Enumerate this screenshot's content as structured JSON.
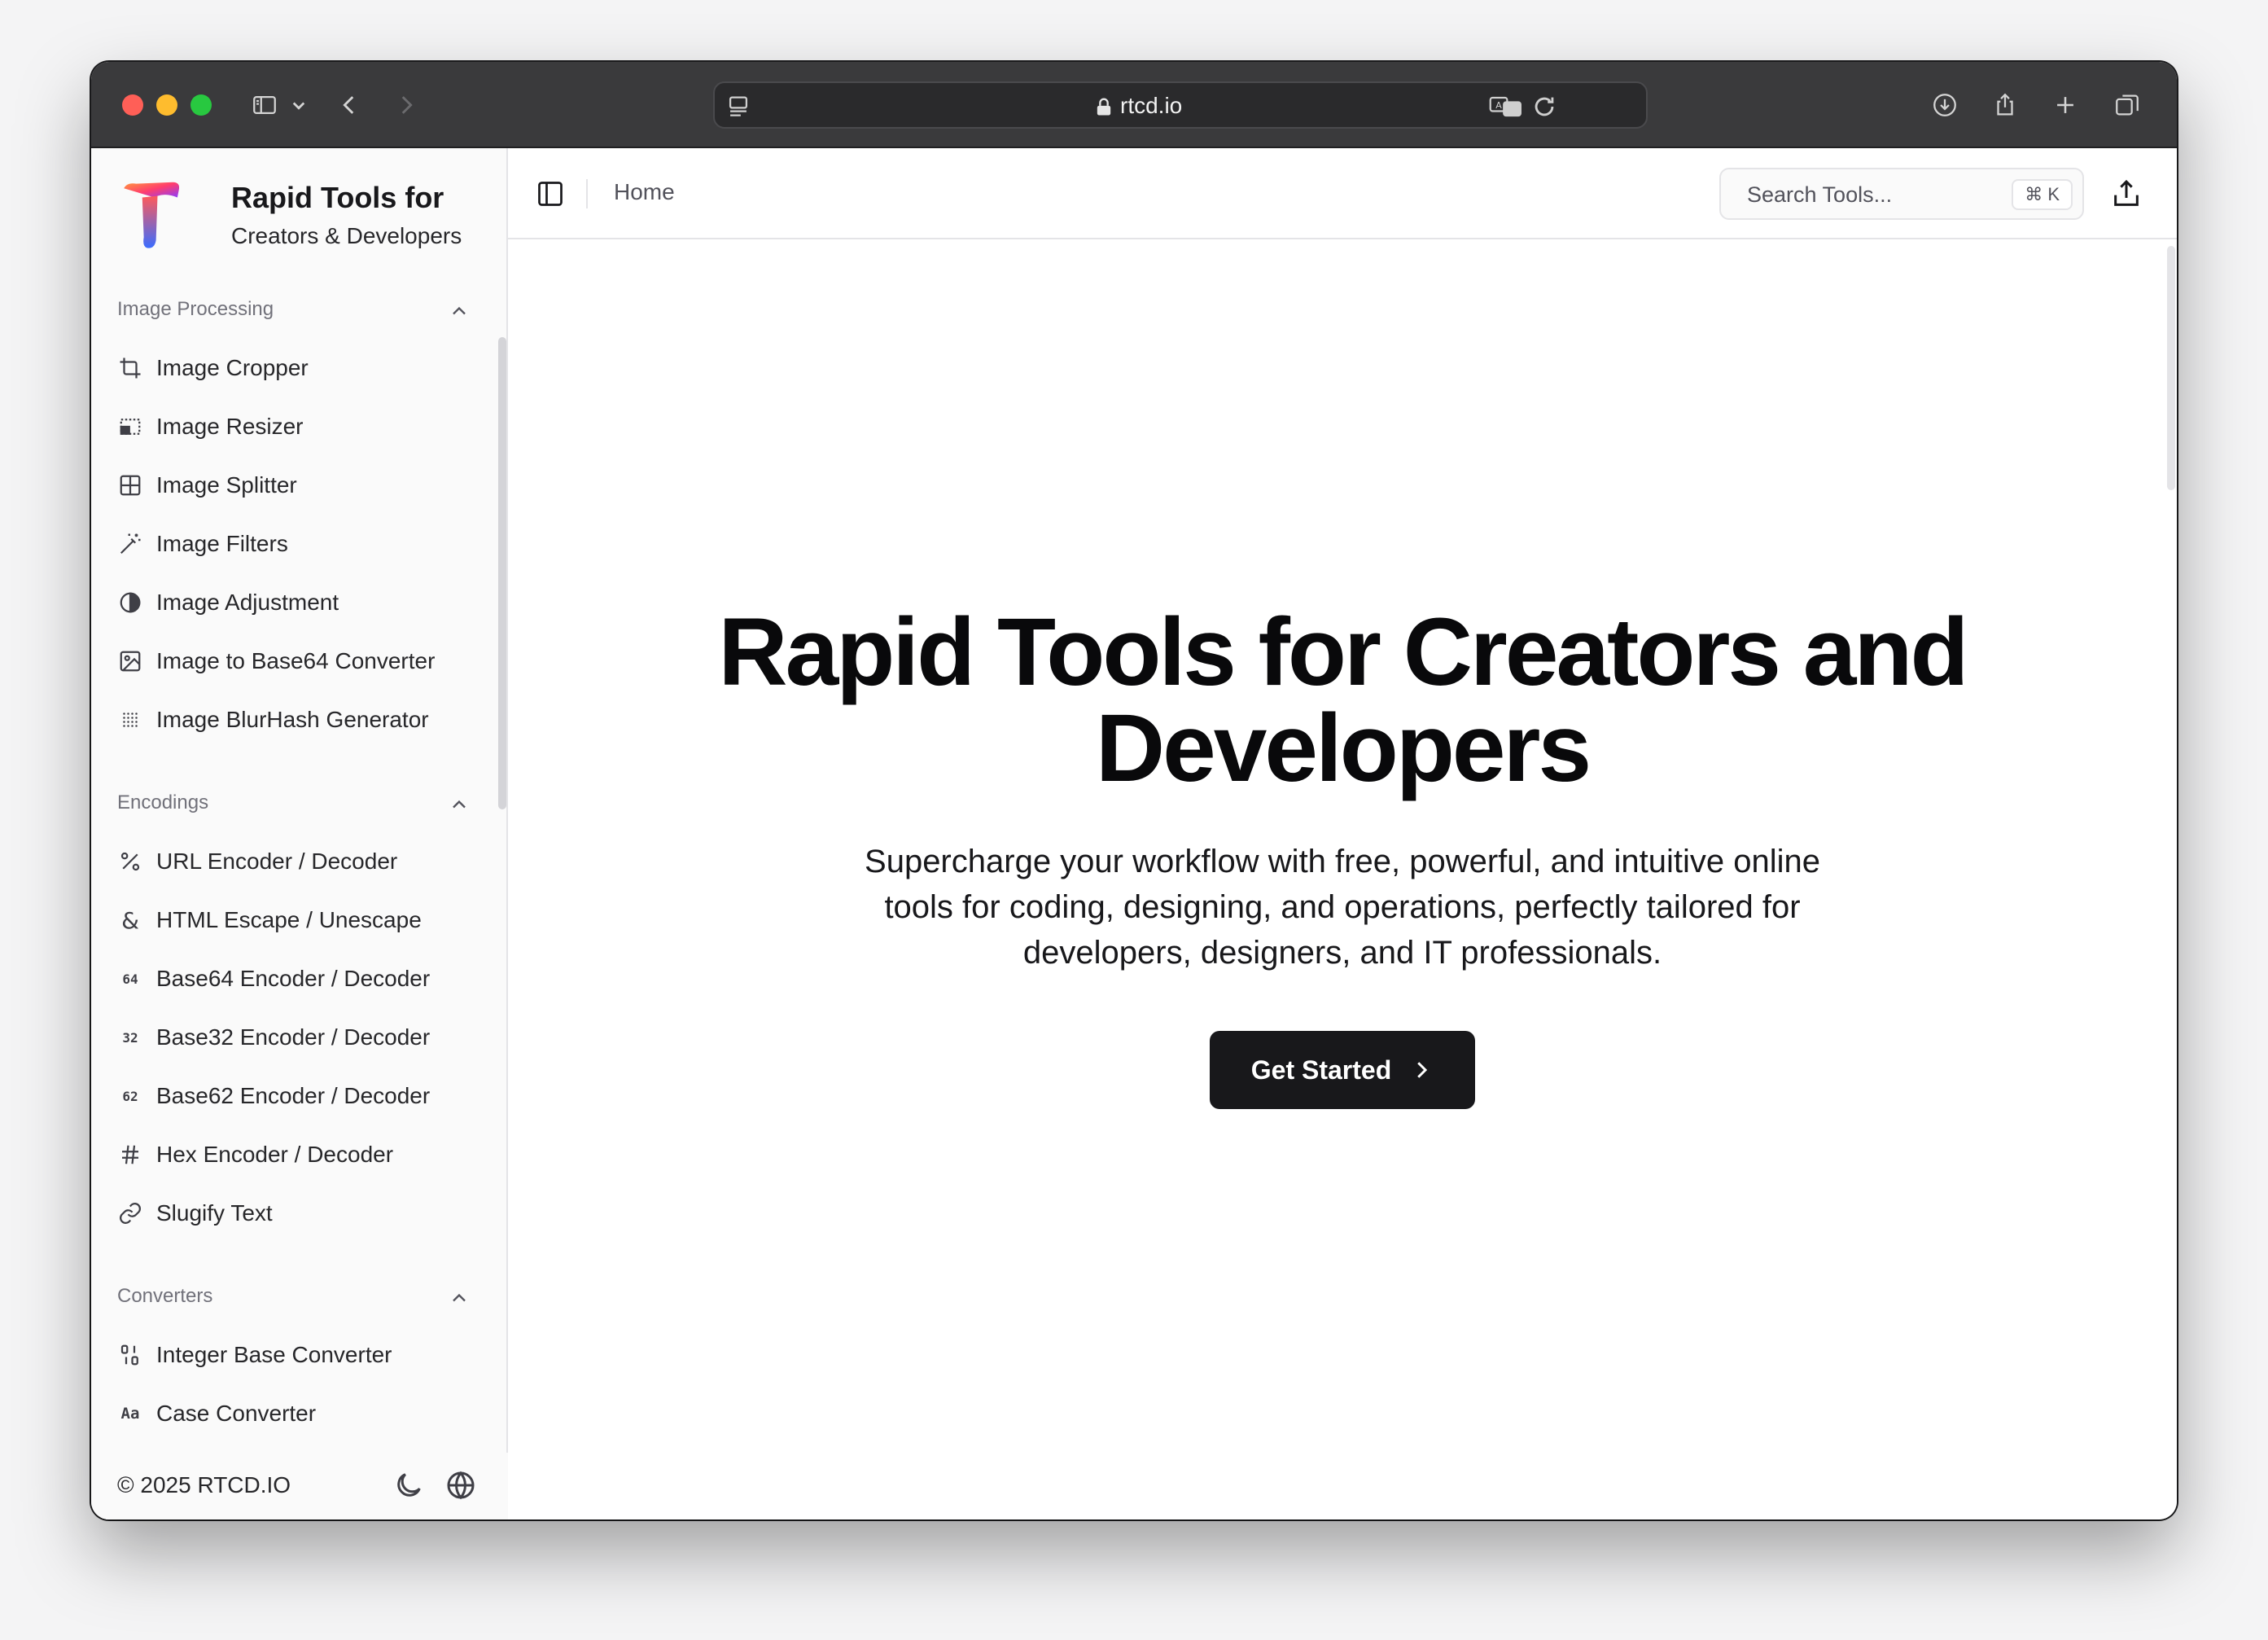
{
  "browser": {
    "url": "rtcd.io"
  },
  "sidebar": {
    "brand_line1": "Rapid Tools for",
    "brand_line2": "Creators & Developers",
    "groups": [
      {
        "title": "Image Processing",
        "items": [
          {
            "label": "Image Cropper",
            "icon": "crop-icon"
          },
          {
            "label": "Image Resizer",
            "icon": "resize-icon"
          },
          {
            "label": "Image Splitter",
            "icon": "grid-icon"
          },
          {
            "label": "Image Filters",
            "icon": "wand-icon"
          },
          {
            "label": "Image Adjustment",
            "icon": "contrast-icon"
          },
          {
            "label": "Image to Base64 Converter",
            "icon": "image-code-icon"
          },
          {
            "label": "Image BlurHash Generator",
            "icon": "dots-grid-icon"
          }
        ]
      },
      {
        "title": "Encodings",
        "items": [
          {
            "label": "URL Encoder / Decoder",
            "icon": "percent-icon"
          },
          {
            "label": "HTML Escape / Unescape",
            "icon": "ampersand-icon"
          },
          {
            "label": "Base64 Encoder / Decoder",
            "icon": "64-icon",
            "glyph": "64"
          },
          {
            "label": "Base32 Encoder / Decoder",
            "icon": "32-icon",
            "glyph": "32"
          },
          {
            "label": "Base62 Encoder / Decoder",
            "icon": "62-icon",
            "glyph": "62"
          },
          {
            "label": "Hex Encoder / Decoder",
            "icon": "hash-icon"
          },
          {
            "label": "Slugify Text",
            "icon": "link-icon"
          }
        ]
      },
      {
        "title": "Converters",
        "items": [
          {
            "label": "Integer Base Converter",
            "icon": "binary-icon"
          },
          {
            "label": "Case Converter",
            "icon": "case-icon",
            "glyph": "Aa"
          }
        ]
      }
    ],
    "footer_copyright": "© 2025 RTCD.IO"
  },
  "header": {
    "breadcrumb": "Home",
    "search_placeholder": "Search Tools...",
    "search_shortcut": "⌘ K"
  },
  "hero": {
    "title": "Rapid Tools for Creators and Developers",
    "subtitle": "Supercharge your workflow with free, powerful, and intuitive online tools for coding, designing, and operations, perfectly tailored for developers, designers, and IT professionals.",
    "cta_label": "Get Started"
  },
  "colors": {
    "accent": "#18181b",
    "sidebar_bg": "#fafafa",
    "titlebar_bg": "#3a3a3c"
  }
}
